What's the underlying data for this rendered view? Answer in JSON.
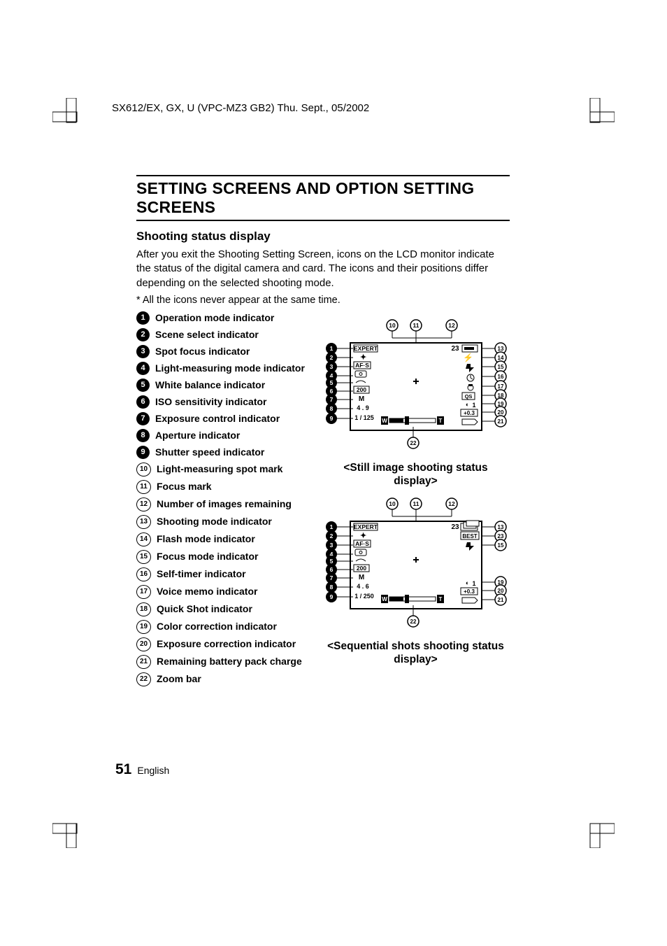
{
  "header": "SX612/EX, GX, U (VPC-MZ3 GB2)    Thu. Sept., 05/2002",
  "section_title": "SETTING SCREENS AND OPTION SETTING SCREENS",
  "subheading": "Shooting status display",
  "body": "After you exit the Shooting Setting Screen, icons on the LCD monitor indicate the status of the digital camera and card. The icons and their positions differ depending on the selected shooting mode.",
  "note": "*  All the icons never appear at the same time.",
  "legend": [
    {
      "n": "1",
      "label": "Operation mode indicator"
    },
    {
      "n": "2",
      "label": "Scene select indicator"
    },
    {
      "n": "3",
      "label": "Spot focus indicator"
    },
    {
      "n": "4",
      "label": "Light-measuring mode indicator"
    },
    {
      "n": "5",
      "label": "White balance indicator"
    },
    {
      "n": "6",
      "label": "ISO sensitivity indicator"
    },
    {
      "n": "7",
      "label": "Exposure control indicator"
    },
    {
      "n": "8",
      "label": "Aperture indicator"
    },
    {
      "n": "9",
      "label": "Shutter speed indicator"
    },
    {
      "n": "10",
      "label": "Light-measuring spot mark"
    },
    {
      "n": "11",
      "label": "Focus mark"
    },
    {
      "n": "12",
      "label": "Number of images remaining"
    },
    {
      "n": "13",
      "label": "Shooting mode indicator"
    },
    {
      "n": "14",
      "label": "Flash mode indicator"
    },
    {
      "n": "15",
      "label": "Focus mode indicator"
    },
    {
      "n": "16",
      "label": "Self-timer indicator"
    },
    {
      "n": "17",
      "label": "Voice memo indicator"
    },
    {
      "n": "18",
      "label": "Quick Shot indicator"
    },
    {
      "n": "19",
      "label": "Color correction indicator"
    },
    {
      "n": "20",
      "label": "Exposure correction indicator"
    },
    {
      "n": "21",
      "label": "Remaining battery pack charge"
    },
    {
      "n": "22",
      "label": "Zoom bar"
    }
  ],
  "caption1": "<Still image shooting status display>",
  "caption2": "<Sequential shots shooting status display>",
  "diagram1": {
    "top": {
      "n10": "10",
      "n11": "11",
      "n12": "12"
    },
    "left_nums": [
      "1",
      "2",
      "3",
      "4",
      "5",
      "6",
      "7",
      "8",
      "9"
    ],
    "right_nums": [
      "13",
      "14",
      "15",
      "16",
      "17",
      "18",
      "19",
      "20",
      "21"
    ],
    "bottom_num": "22",
    "lcd": {
      "expert": "EXPERT",
      "afs": "AF·S",
      "iso": "200",
      "mode": "M",
      "aperture": "4 . 9",
      "shutter": "1 / 125",
      "count": "23",
      "qs": "QS",
      "cc1": "1",
      "ec": "+0.3",
      "w": "W",
      "t": "T"
    }
  },
  "diagram2": {
    "top": {
      "n10": "10",
      "n11": "11",
      "n12": "12"
    },
    "left_nums": [
      "1",
      "2",
      "3",
      "4",
      "5",
      "6",
      "7",
      "8",
      "9"
    ],
    "right_nums": [
      "13",
      "23",
      "15",
      "19",
      "20",
      "21"
    ],
    "bottom_num": "22",
    "lcd": {
      "expert": "EXPERT",
      "afs": "AF·S",
      "iso": "200",
      "mode": "M",
      "aperture": "4 . 6",
      "shutter": "1 / 250",
      "count": "23",
      "best": "BEST",
      "cc1": "1",
      "ec": "+0.3",
      "w": "W",
      "t": "T"
    }
  },
  "page_number": "51",
  "page_lang": "English"
}
